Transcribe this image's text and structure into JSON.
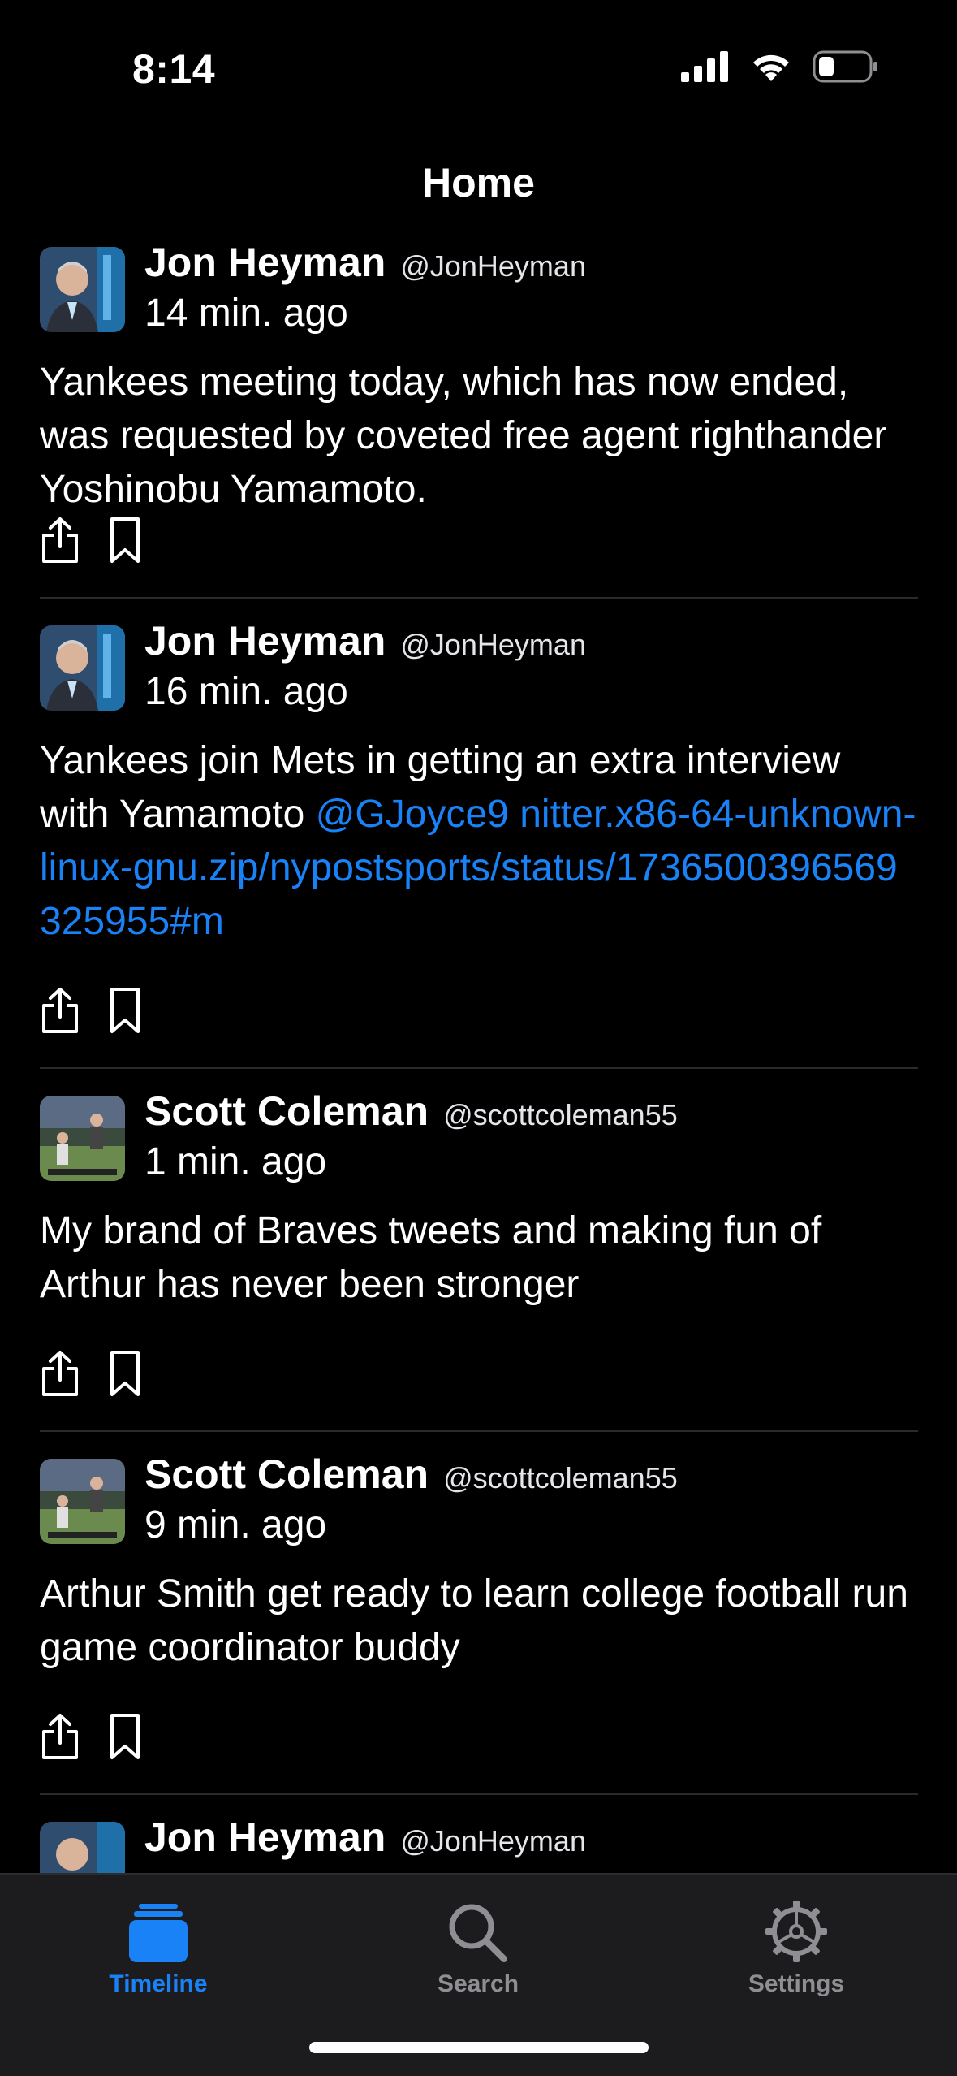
{
  "status_bar": {
    "time": "8:14"
  },
  "nav": {
    "title": "Home"
  },
  "posts": [
    {
      "name": "Jon Heyman",
      "handle": "@JonHeyman",
      "time": "14 min. ago",
      "text": "Yankees meeting today, which has now ended, was requested by coveted free agent righthander Yoshinobu Yamamoto."
    },
    {
      "name": "Jon Heyman",
      "handle": "@JonHeyman",
      "time": "16 min. ago",
      "text": "Yankees join Mets in getting an extra interview with Yamamoto ",
      "mention": "@GJoyce9",
      "link": "nitter.x86-64-unknown-linux-gnu.zip/nypostsports/status/1736500396569325955#m"
    },
    {
      "name": "Scott Coleman",
      "handle": "@scottcoleman55",
      "time": "1 min. ago",
      "text": "My brand of Braves tweets and making fun of Arthur has never been stronger"
    },
    {
      "name": "Scott Coleman",
      "handle": "@scottcoleman55",
      "time": "9 min. ago",
      "text": "Arthur Smith get ready to learn college football run game coordinator buddy"
    },
    {
      "name": "Jon Heyman",
      "handle": "@JonHeyman"
    }
  ],
  "tabs": [
    {
      "label": "Timeline",
      "icon": "stack-icon",
      "active": true
    },
    {
      "label": "Search",
      "icon": "magnifier-icon",
      "active": false
    },
    {
      "label": "Settings",
      "icon": "gear-icon",
      "active": false
    }
  ],
  "colors": {
    "accent": "#1a82f7",
    "background": "#000000",
    "tabbar": "#1c1c1e"
  }
}
